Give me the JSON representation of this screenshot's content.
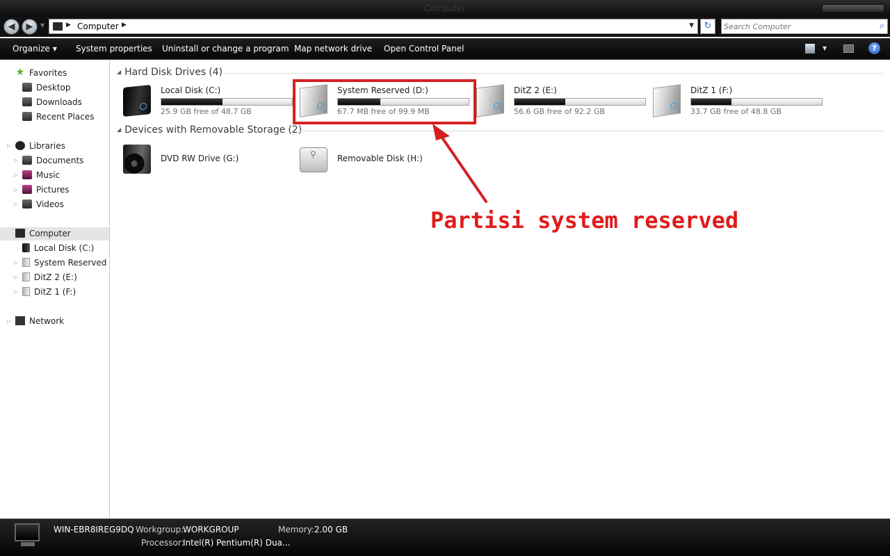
{
  "window": {
    "title": "Computer"
  },
  "address": {
    "crumbs": [
      "Computer"
    ],
    "search_placeholder": "Search Computer"
  },
  "toolbar": {
    "organize": "Organize",
    "system_properties": "System properties",
    "uninstall": "Uninstall or change a program",
    "map_drive": "Map network drive",
    "control_panel": "Open Control Panel"
  },
  "navpane": {
    "favorites": {
      "label": "Favorites",
      "items": [
        "Desktop",
        "Downloads",
        "Recent Places"
      ]
    },
    "libraries": {
      "label": "Libraries",
      "items": [
        "Documents",
        "Music",
        "Pictures",
        "Videos"
      ]
    },
    "computer": {
      "label": "Computer",
      "items": [
        "Local Disk (C:)",
        "System Reserved (D:)",
        "DitZ 2 (E:)",
        "DitZ 1 (F:)"
      ]
    },
    "network": {
      "label": "Network"
    }
  },
  "groups": {
    "hdd": {
      "title": "Hard Disk Drives",
      "count": "(4)"
    },
    "removable": {
      "title": "Devices with Removable Storage",
      "count": "(2)"
    }
  },
  "drives": [
    {
      "name": "Local Disk (C:)",
      "free": "25.9 GB free of 48.7 GB",
      "used_fraction": 0.468
    },
    {
      "name": "System Reserved (D:)",
      "free": "67.7 MB free of 99.9 MB",
      "used_fraction": 0.322
    },
    {
      "name": "DitZ 2 (E:)",
      "free": "56.6 GB free of 92.2 GB",
      "used_fraction": 0.386
    },
    {
      "name": "DitZ 1 (F:)",
      "free": "33.7 GB free of 48.8 GB",
      "used_fraction": 0.309
    }
  ],
  "removable": [
    {
      "name": "DVD RW Drive (G:)"
    },
    {
      "name": "Removable Disk (H:)"
    }
  ],
  "annotation": {
    "text": "Partisi system reserved",
    "color": "#e01b1b"
  },
  "details": {
    "computer_name": "WIN-EBR8IREG9DQ",
    "workgroup_label": "Workgroup:",
    "workgroup": "WORKGROUP",
    "memory_label": "Memory:",
    "memory": "2.00 GB",
    "processor_label": "Processor:",
    "processor": "Intel(R) Pentium(R) Dua..."
  }
}
